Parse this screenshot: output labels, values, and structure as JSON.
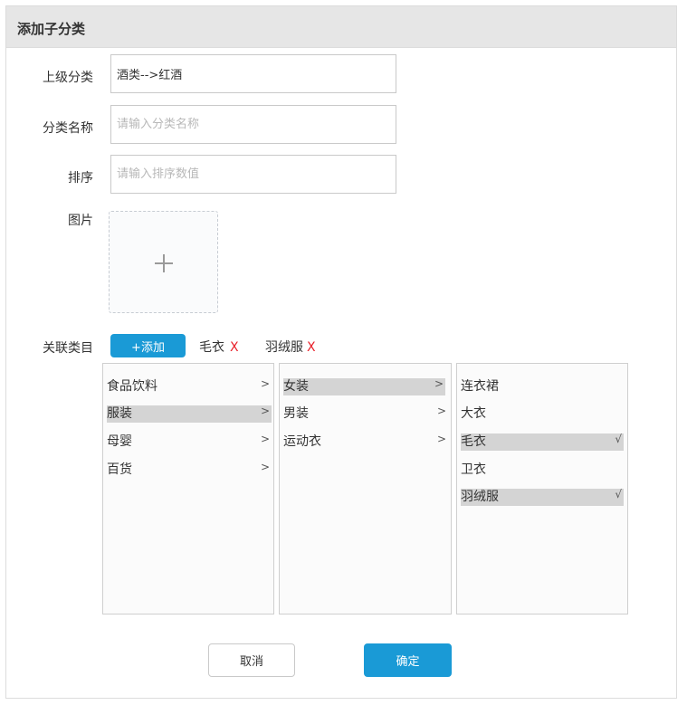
{
  "dialog": {
    "title": "添加子分类"
  },
  "form": {
    "parent": {
      "label": "上级分类",
      "value": "酒类-->红酒"
    },
    "name": {
      "label": "分类名称",
      "placeholder": "请输入分类名称"
    },
    "sort": {
      "label": "排序",
      "placeholder": "请输入排序数值"
    },
    "image": {
      "label": "图片"
    },
    "related": {
      "label": "关联类目",
      "add_label": "+添加",
      "tags": [
        {
          "label": "毛衣",
          "remove": "X"
        },
        {
          "label": "羽绒服",
          "remove": "X"
        }
      ]
    }
  },
  "columns": [
    {
      "items": [
        {
          "label": "食品饮料",
          "marker": ">",
          "selected": false
        },
        {
          "label": "服装",
          "marker": ">",
          "selected": true
        },
        {
          "label": "母婴",
          "marker": ">",
          "selected": false
        },
        {
          "label": "百货",
          "marker": ">",
          "selected": false
        }
      ]
    },
    {
      "items": [
        {
          "label": "女装",
          "marker": ">",
          "selected": true
        },
        {
          "label": "男装",
          "marker": ">",
          "selected": false
        },
        {
          "label": "运动衣",
          "marker": ">",
          "selected": false
        }
      ]
    },
    {
      "items": [
        {
          "label": "连衣裙",
          "marker": "",
          "selected": false
        },
        {
          "label": "大衣",
          "marker": "",
          "selected": false
        },
        {
          "label": "毛衣",
          "marker": "√",
          "selected": true
        },
        {
          "label": "卫衣",
          "marker": "",
          "selected": false
        },
        {
          "label": "羽绒服",
          "marker": "√",
          "selected": true
        }
      ]
    }
  ],
  "actions": {
    "cancel_label": "取消",
    "confirm_label": "确定"
  },
  "colors": {
    "accent": "#1a9ad6",
    "remove": "#e8202a",
    "selected_row": "#d4d4d4",
    "header_bg": "#e6e6e6"
  }
}
